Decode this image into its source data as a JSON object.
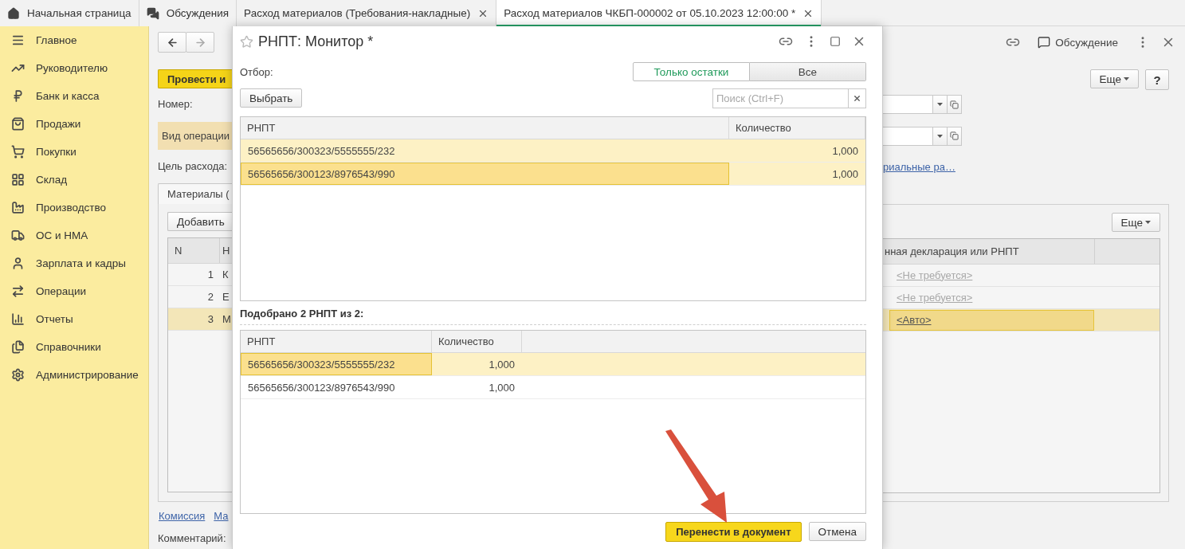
{
  "tabs": [
    {
      "label": "Начальная страница",
      "selected": false,
      "closable": false
    },
    {
      "label": "Обсуждения",
      "selected": false,
      "closable": false
    },
    {
      "label": "Расход материалов (Требования-накладные)",
      "selected": false,
      "closable": true
    },
    {
      "label": "Расход материалов ЧКБП-000002 от 05.10.2023 12:00:00 *",
      "selected": true,
      "closable": true
    }
  ],
  "sidebar": {
    "items": [
      {
        "label": "Главное"
      },
      {
        "label": "Руководителю"
      },
      {
        "label": "Банк и касса"
      },
      {
        "label": "Продажи"
      },
      {
        "label": "Покупки"
      },
      {
        "label": "Склад"
      },
      {
        "label": "Производство"
      },
      {
        "label": "ОС и НМА"
      },
      {
        "label": "Зарплата и кадры"
      },
      {
        "label": "Операции"
      },
      {
        "label": "Отчеты"
      },
      {
        "label": "Справочники"
      },
      {
        "label": "Администрирование"
      }
    ]
  },
  "document": {
    "post_button": "Провести и",
    "discussion_button": "Обсуждение",
    "more_button": "Еще",
    "help_button": "?",
    "number_label": "Номер:",
    "operation_label": "Вид операции",
    "purpose_label": "Цель расхода:",
    "link": "риальные ра…",
    "materials_tab": "Материалы (",
    "add_button": "Добавить",
    "table_more_button": "Еще",
    "table": {
      "columns": [
        "N",
        "Н",
        "нная декларация или РНПТ"
      ],
      "rows": [
        {
          "n": "1",
          "name": "К",
          "declaration": "<Не требуется>",
          "kind": "hint",
          "selected": false
        },
        {
          "n": "2",
          "name": "Е",
          "declaration": "<Не требуется>",
          "kind": "hint",
          "selected": false
        },
        {
          "n": "3",
          "name": "М",
          "declaration": "<Авто>",
          "kind": "value",
          "selected": true
        }
      ]
    },
    "footer_links": [
      "Комиссия",
      "Ма"
    ],
    "comment_label": "Комментарий:"
  },
  "dialog": {
    "title": "РНПТ: Монитор *",
    "filter_label": "Отбор:",
    "filter_options": [
      {
        "label": "Только остатки",
        "selected": true
      },
      {
        "label": "Все",
        "selected": false
      }
    ],
    "select_button": "Выбрать",
    "search": {
      "placeholder": "Поиск (Ctrl+F)"
    },
    "available": {
      "columns": [
        "РНПТ",
        "Количество"
      ],
      "rows": [
        {
          "rnpt": "56565656/300323/5555555/232",
          "quantity": "1,000",
          "selected": true,
          "current": false
        },
        {
          "rnpt": "56565656/300123/8976543/990",
          "quantity": "1,000",
          "selected": true,
          "current": true
        }
      ]
    },
    "picked_caption": "Подобрано 2 РНПТ из 2:",
    "picked": {
      "columns": [
        "РНПТ",
        "Количество"
      ],
      "rows": [
        {
          "rnpt": "56565656/300323/5555555/232",
          "quantity": "1,000",
          "selected": true
        },
        {
          "rnpt": "56565656/300123/8976543/990",
          "quantity": "1,000",
          "selected": false
        }
      ]
    },
    "ok_button": "Перенести в документ",
    "cancel_button": "Отмена"
  }
}
